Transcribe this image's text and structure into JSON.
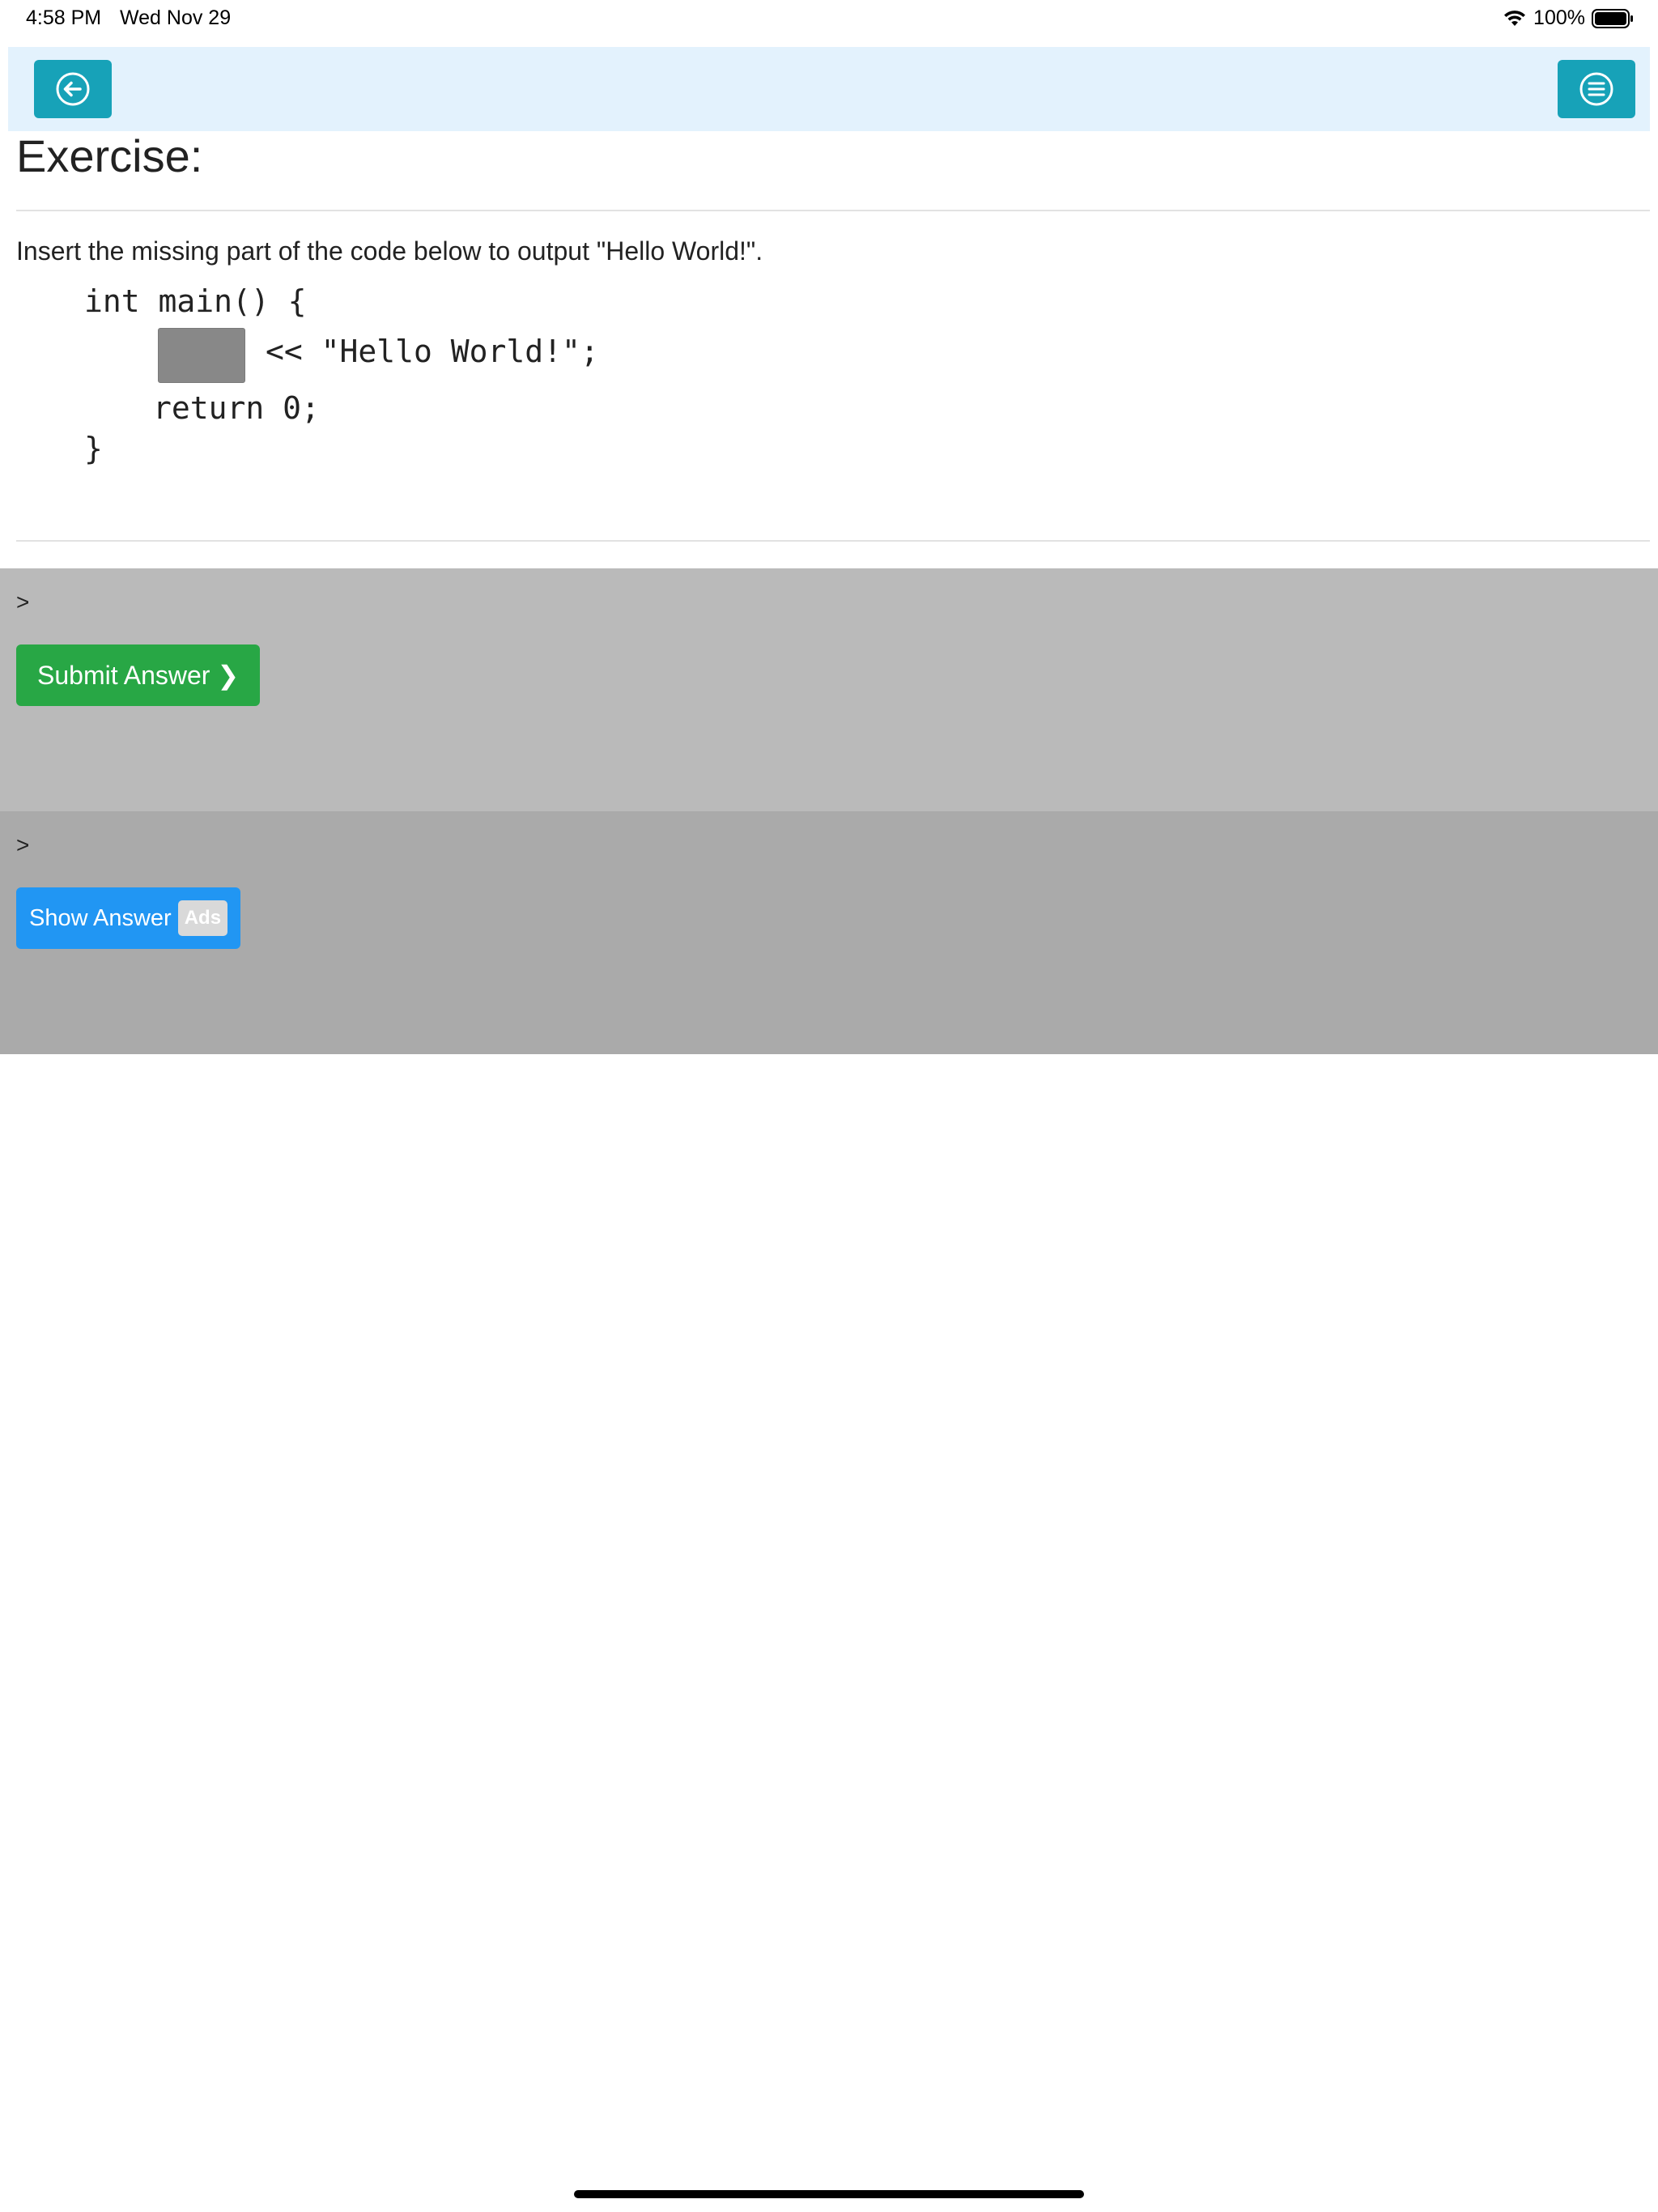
{
  "status_bar": {
    "time": "4:58 PM",
    "date": "Wed Nov 29",
    "battery": "100%"
  },
  "nav": {
    "back_icon": "back-arrow-circle-icon",
    "menu_icon": "menu-lines-circle-icon",
    "accent": "#17a2b8",
    "background": "#e3f2fd"
  },
  "exercise": {
    "title": "Exercise:",
    "instruction": "Insert the missing part of the code below to output \"Hello World!\".",
    "code": {
      "line1": "int main() {",
      "line2": "<< \"Hello World!\";",
      "line3": "return 0;",
      "line4": "}"
    }
  },
  "submit_panel": {
    "prompt": ">",
    "button_label": "Submit Answer ❯",
    "button_color": "#28a745"
  },
  "show_panel": {
    "prompt": ">",
    "button_label": "Show Answer",
    "badge": "Ads",
    "button_color": "#2196f3"
  }
}
